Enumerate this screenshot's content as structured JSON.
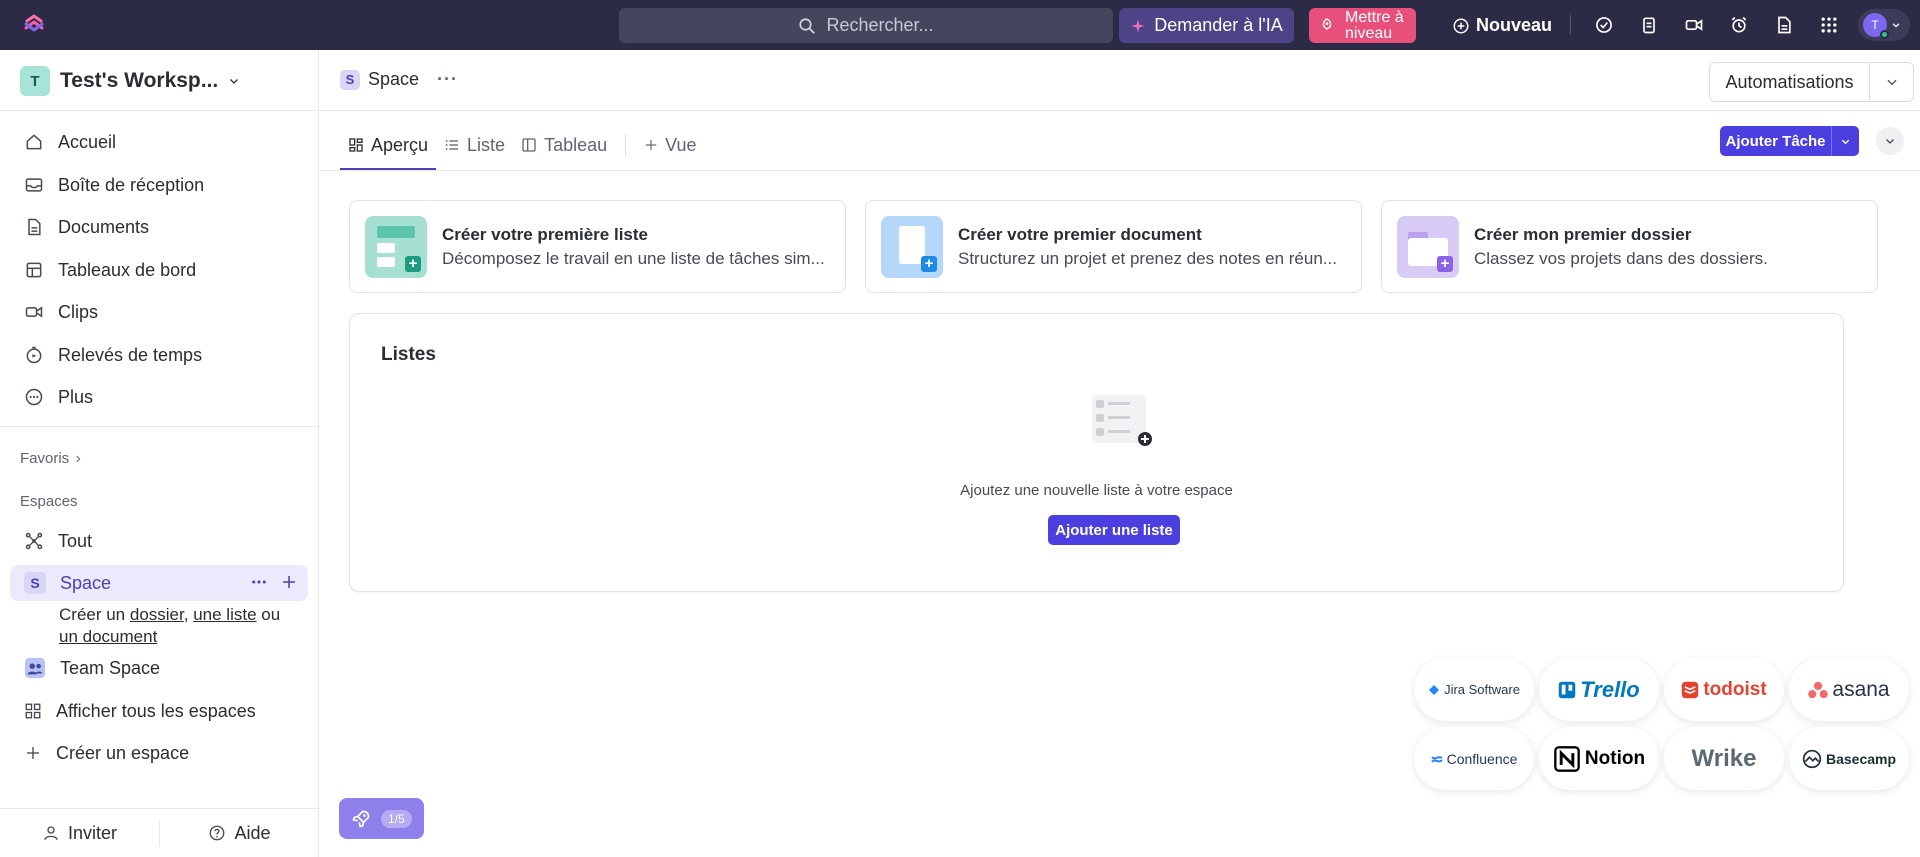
{
  "topbar": {
    "search_placeholder": "Rechercher...",
    "ai_label": "Demander à l'IA",
    "upgrade_label": "Mettre à niveau",
    "new_label": "Nouveau",
    "avatar_initial": "T"
  },
  "sidebar": {
    "workspace_initial": "T",
    "workspace_name": "Test's Worksp...",
    "nav": [
      {
        "label": "Accueil",
        "icon": "home-icon"
      },
      {
        "label": "Boîte de réception",
        "icon": "inbox-icon"
      },
      {
        "label": "Documents",
        "icon": "document-icon"
      },
      {
        "label": "Tableaux de bord",
        "icon": "dashboard-icon"
      },
      {
        "label": "Clips",
        "icon": "video-icon"
      },
      {
        "label": "Relevés de temps",
        "icon": "timer-icon"
      },
      {
        "label": "Plus",
        "icon": "more-icon"
      }
    ],
    "favorites_label": "Favoris",
    "spaces_label": "Espaces",
    "spaces": {
      "all_label": "Tout",
      "space_initial": "S",
      "space_label": "Space",
      "create_prefix": "Créer un",
      "create_folder": "dossier",
      "create_sep": ",",
      "create_list": "une liste",
      "create_or": "ou",
      "create_doc": "un document",
      "team_space_label": "Team Space",
      "all_spaces_label": "Afficher tous les espaces",
      "create_space_label": "Créer un espace"
    },
    "invite_label": "Inviter",
    "help_label": "Aide"
  },
  "header": {
    "space_initial": "S",
    "space_name": "Space",
    "automations_label": "Automatisations"
  },
  "tabs": [
    {
      "label": "Aperçu",
      "active": true
    },
    {
      "label": "Liste",
      "active": false
    },
    {
      "label": "Tableau",
      "active": false
    },
    {
      "label": "Vue",
      "active": false
    }
  ],
  "add_task_label": "Ajouter Tâche",
  "cards": [
    {
      "title": "Créer votre première liste",
      "desc": "Décomposez le travail en une liste de tâches sim...",
      "color": "#7fd3c0"
    },
    {
      "title": "Créer votre premier document",
      "desc": "Structurez un projet et prenez des notes en réun...",
      "color": "#8fc0f2"
    },
    {
      "title": "Créer mon premier dossier",
      "desc": "Classez vos projets dans des dossiers.",
      "color": "#c4b5ef"
    }
  ],
  "lists_panel": {
    "title": "Listes",
    "empty_text": "Ajoutez une nouvelle liste à votre espace",
    "add_button": "Ajouter une liste"
  },
  "integrations": [
    "Jira Software",
    "Trello",
    "todoist",
    "asana",
    "Confluence",
    "Notion",
    "Wrike",
    "Basecamp"
  ],
  "onboarding": {
    "progress": "1/5"
  },
  "colors": {
    "accent": "#4c3fe0",
    "topbar": "#2b2b45",
    "upgrade": "#e6507a",
    "ai": "#4c4486"
  }
}
